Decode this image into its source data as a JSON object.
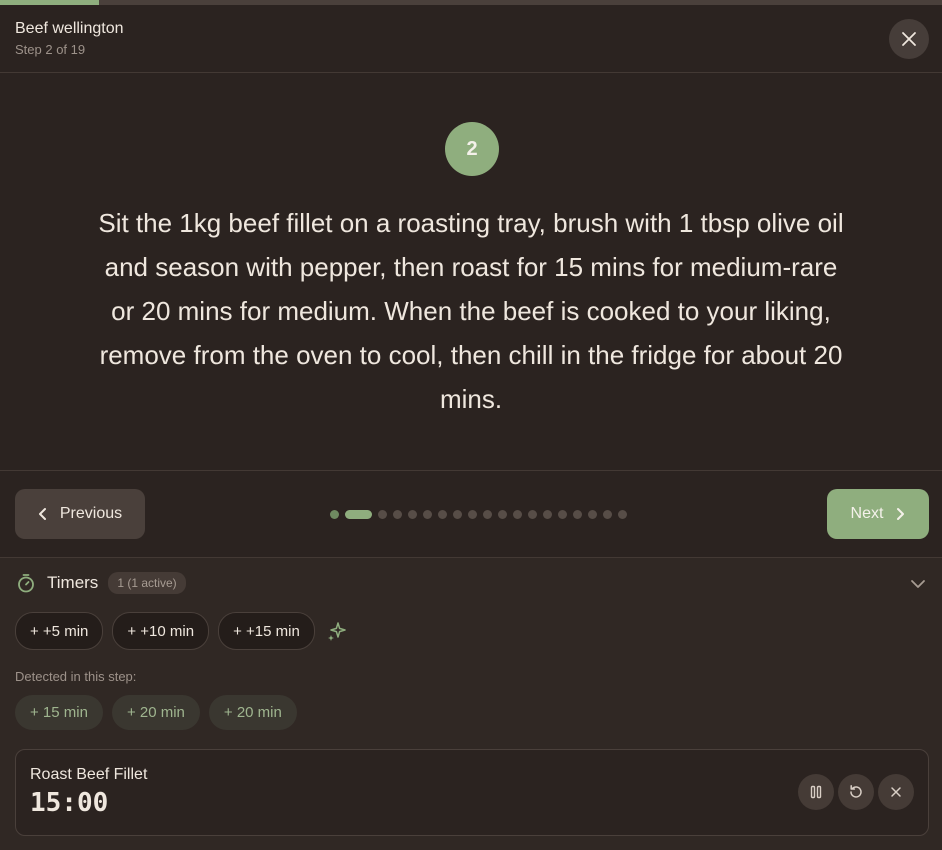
{
  "progress": {
    "fraction": 0.105
  },
  "header": {
    "recipe_title": "Beef wellington",
    "step_label": "Step 2 of 19",
    "close_icon": "close-icon"
  },
  "step": {
    "number": "2",
    "instruction": "Sit the 1kg beef fillet on a roasting tray, brush with 1 tbsp olive oil and season with pepper, then roast for 15 mins for medium-rare or 20 mins for medium. When the beef is cooked to your liking, remove from the oven to cool, then chill in the fridge for about 20 mins."
  },
  "nav": {
    "previous_label": "Previous",
    "next_label": "Next",
    "total_steps": 19,
    "current_step": 2
  },
  "timers": {
    "title": "Timers",
    "badge": "1 (1 active)",
    "quick_add": [
      "+ +5 min",
      "+ +10 min",
      "+ +15 min"
    ],
    "detected_label": "Detected in this step:",
    "detected": [
      "+ 15 min",
      "+ 20 min",
      "+ 20 min"
    ],
    "active": [
      {
        "name": "Roast Beef Fillet",
        "time": "15:00"
      }
    ]
  },
  "colors": {
    "background": "#2b2320",
    "accent": "#8fae7e",
    "text": "#efe7de",
    "muted": "#9d928a"
  }
}
